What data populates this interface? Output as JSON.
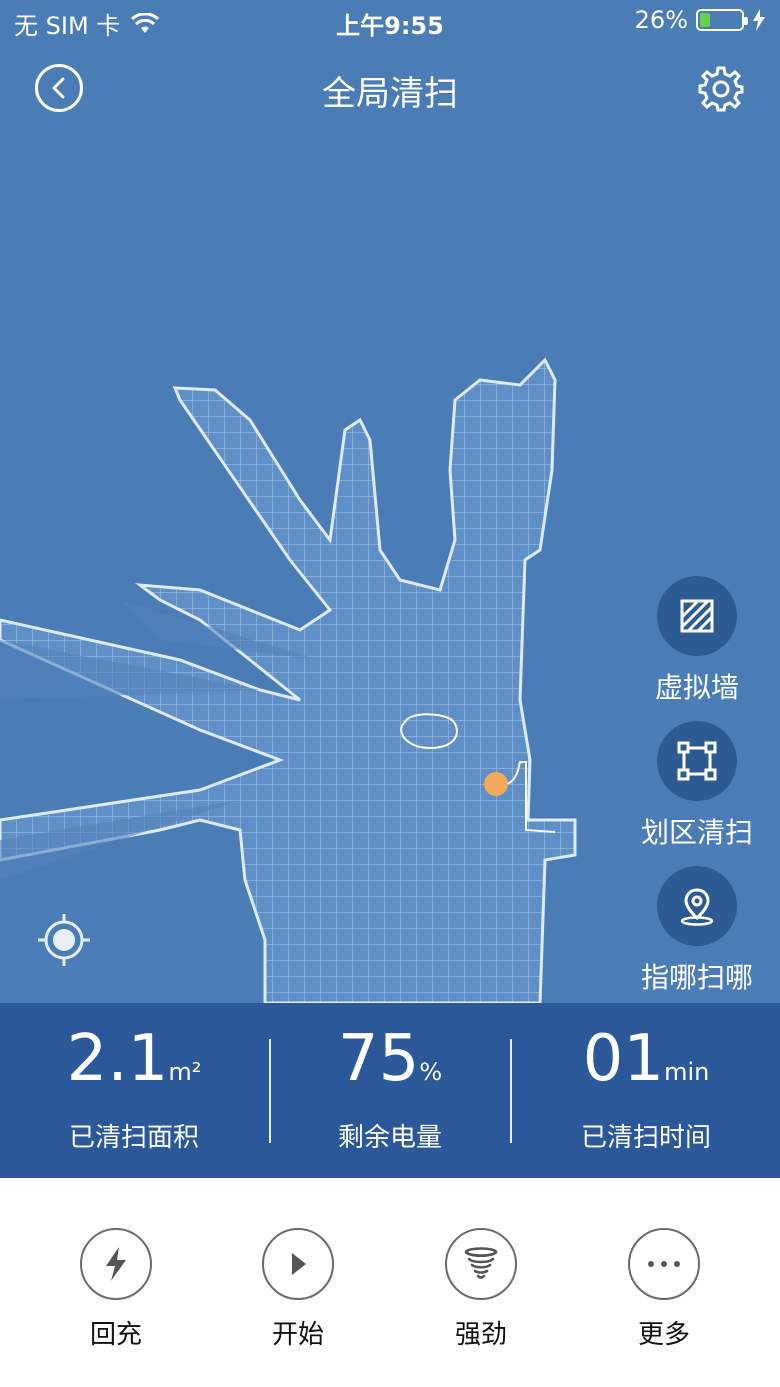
{
  "status_bar": {
    "carrier": "无 SIM 卡",
    "time": "上午9:55",
    "battery_percent": "26%",
    "battery_level": 0.26
  },
  "nav": {
    "title": "全局清扫",
    "back_icon": "back-chevron-icon",
    "settings_icon": "gear-icon"
  },
  "map": {
    "robot_color": "#f4a95b",
    "map_color": "#5a8ac2",
    "background_color": "#4a7cb6"
  },
  "side_actions": [
    {
      "label": "虚拟墙",
      "icon": "virtual-wall-icon"
    },
    {
      "label": "划区清扫",
      "icon": "zone-select-icon"
    },
    {
      "label": "指哪扫哪",
      "icon": "location-pin-icon"
    }
  ],
  "stats": {
    "area_value": "2.1",
    "area_unit": "m²",
    "area_label": "已清扫面积",
    "battery_value": "75",
    "battery_unit": "%",
    "battery_label": "剩余电量",
    "time_value": "01",
    "time_unit": "min",
    "time_label": "已清扫时间"
  },
  "controls": [
    {
      "label": "回充",
      "icon": "lightning-icon"
    },
    {
      "label": "开始",
      "icon": "play-icon"
    },
    {
      "label": "强劲",
      "icon": "tornado-icon"
    },
    {
      "label": "更多",
      "icon": "more-dots-icon"
    }
  ]
}
